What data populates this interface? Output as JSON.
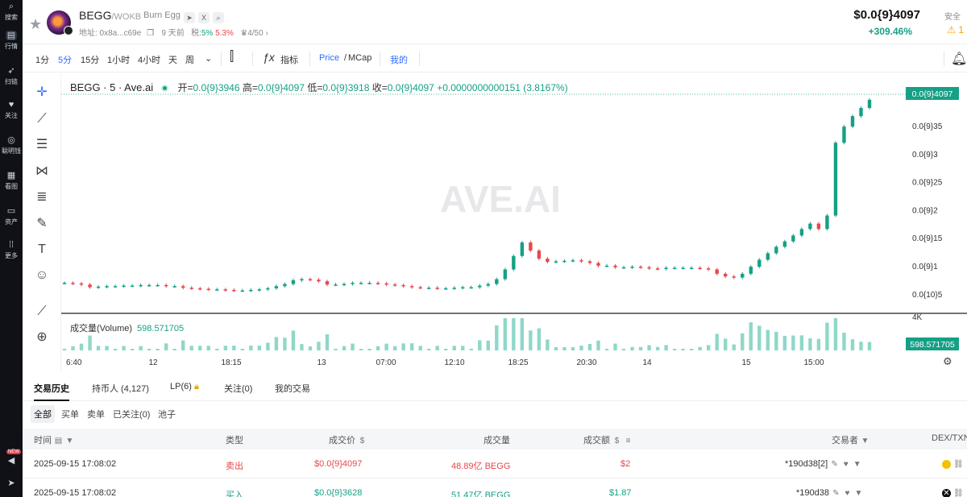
{
  "sidebar": {
    "items": [
      {
        "label": "搜索",
        "icon": "search-icon"
      },
      {
        "label": "行情",
        "icon": "chart-icon"
      },
      {
        "label": "扫链",
        "icon": "rocket-icon"
      },
      {
        "label": "关注",
        "icon": "heart-icon"
      },
      {
        "label": "聪明钱",
        "icon": "compass-icon"
      },
      {
        "label": "看图",
        "icon": "grid-icon"
      },
      {
        "label": "资产",
        "icon": "wallet-icon"
      },
      {
        "label": "更多",
        "icon": "more-icon"
      }
    ],
    "new_badge": "NEW"
  },
  "header": {
    "symbol": "BEGG",
    "pair": "/WOKB",
    "token_name": "Burn Egg",
    "address_label": "地址: 0x8a...c69e",
    "age": "9 天前",
    "tax_label": "税:",
    "tax_buy": "5%",
    "tax_sell": "5.3%",
    "holders_rank": "4/50",
    "price": "$0.0{9}4097",
    "change": "+309.46%",
    "safety_label": "安全",
    "warn_count": "1"
  },
  "toolbar": {
    "intervals": [
      "1分",
      "5分",
      "15分",
      "1小时",
      "4小时",
      "天",
      "周"
    ],
    "active_interval": "5分",
    "indicator_label": "指标",
    "price_label": "Price",
    "mcap_label": "MCap",
    "mine_label": "我的"
  },
  "chart": {
    "title": "BEGG · 5 · Ave.ai",
    "open_label": "开=",
    "open": "0.0{9}3946",
    "high_label": "高=",
    "high": "0.0{9}4097",
    "low_label": "低=",
    "low": "0.0{9}3918",
    "close_label": "收=",
    "close": "0.0{9}4097",
    "change": "+0.0000000000151 (3.8167%)",
    "watermark": "AVE.AI",
    "volume_label": "成交量(Volume)",
    "volume_value": "598.571705",
    "last_price_tag": "0.0{9}4097",
    "volume_tag": "598.571705",
    "vol_axis_label": "4K",
    "colors": {
      "up": "#16a085",
      "down": "#e5484d"
    }
  },
  "chart_data": {
    "type": "candlestick",
    "title": "BEGG · 5 · Ave.ai",
    "y_axis_ticks": [
      "0.0{9}35",
      "0.0{9}3",
      "0.0{9}25",
      "0.0{9}2",
      "0.0{9}15",
      "0.0{9}1",
      "0.0{10}5"
    ],
    "x_axis_ticks": [
      "6:40",
      "12",
      "18:15",
      "13",
      "07:00",
      "12:10",
      "18:25",
      "20:30",
      "14",
      "15",
      "15:00"
    ],
    "unit": "1e-9 USD",
    "ylim": [
      0.03,
      0.42
    ],
    "close": [
      0.07,
      0.069,
      0.067,
      0.062,
      0.063,
      0.064,
      0.064,
      0.065,
      0.065,
      0.066,
      0.066,
      0.066,
      0.064,
      0.064,
      0.061,
      0.06,
      0.059,
      0.058,
      0.058,
      0.057,
      0.056,
      0.056,
      0.057,
      0.058,
      0.06,
      0.064,
      0.068,
      0.075,
      0.077,
      0.076,
      0.073,
      0.067,
      0.067,
      0.068,
      0.07,
      0.07,
      0.07,
      0.069,
      0.067,
      0.066,
      0.064,
      0.062,
      0.061,
      0.061,
      0.06,
      0.06,
      0.061,
      0.062,
      0.062,
      0.065,
      0.068,
      0.077,
      0.095,
      0.12,
      0.145,
      0.13,
      0.115,
      0.109,
      0.11,
      0.111,
      0.112,
      0.11,
      0.107,
      0.102,
      0.102,
      0.099,
      0.099,
      0.1,
      0.099,
      0.097,
      0.096,
      0.098,
      0.098,
      0.098,
      0.098,
      0.097,
      0.095,
      0.087,
      0.082,
      0.08,
      0.087,
      0.1,
      0.113,
      0.125,
      0.137,
      0.147,
      0.158,
      0.17,
      0.18,
      0.17,
      0.195,
      0.33,
      0.36,
      0.3794,
      0.3946,
      0.4097
    ]
  },
  "tabs": [
    {
      "label": "交易历史",
      "active": true
    },
    {
      "label": "持币人 (4,127)",
      "active": false
    },
    {
      "label": "LP(6)",
      "active": false
    },
    {
      "label": "关注(0)",
      "active": false
    },
    {
      "label": "我的交易",
      "active": false
    }
  ],
  "filters": [
    "全部",
    "买单",
    "卖单",
    "已关注(0)",
    "池子"
  ],
  "table": {
    "headers": {
      "time": "时间",
      "type": "类型",
      "price": "成交价",
      "amount": "成交量",
      "value": "成交额",
      "trader": "交易者",
      "dex": "DEX/TXN"
    },
    "rows": [
      {
        "time": "2025-09-15 17:08:02",
        "type": "卖出",
        "side": "sell",
        "price": "$0.0{9}4097",
        "amount": "48.89亿 BEGG",
        "value": "$2",
        "trader": "*190d38[2]"
      },
      {
        "time": "2025-09-15 17:08:02",
        "type": "买入",
        "side": "buy",
        "price": "$0.0{9}3628",
        "amount": "51.47亿 BEGG",
        "value": "$1.87",
        "trader": "*190d38"
      }
    ]
  }
}
